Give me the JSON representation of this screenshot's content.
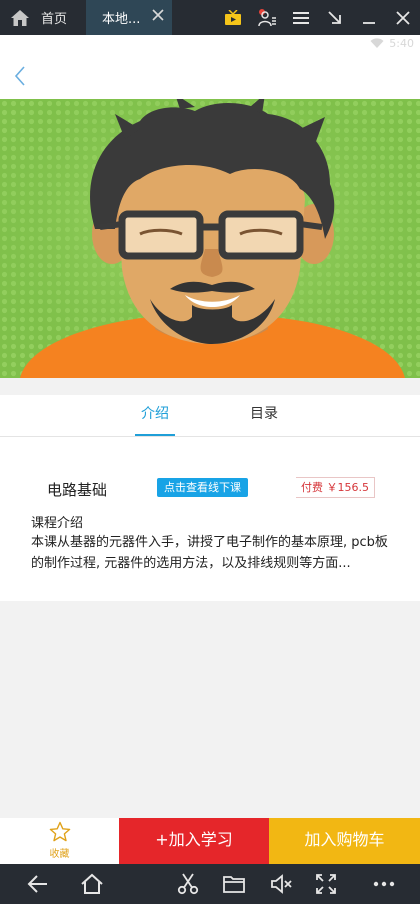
{
  "emulator": {
    "home_tab_label": "首页",
    "active_tab_label": "本地...",
    "tool_icons": [
      "tv-icon",
      "user-settings-icon",
      "menu-icon",
      "minimize-to-corner-icon",
      "minimize-icon",
      "close-icon"
    ],
    "bottom_icons": [
      "back-arrow-icon",
      "home-icon",
      "scissors-icon",
      "folder-icon",
      "mute-icon",
      "fullscreen-icon",
      "more-icon"
    ]
  },
  "status_bar": {
    "time": "5:40"
  },
  "tabs": {
    "intro": "介绍",
    "catalog": "目录"
  },
  "course": {
    "title": "电路基础",
    "offline_button": "点击查看线下课",
    "price": "付费 ￥156.5",
    "intro_label": "课程介绍",
    "intro_text": "本课从基器的元器件入手，讲授了电子制作的基本原理, pcb板的制作过程, 元器件的选用方法，以及排线规则等方面..."
  },
  "actions": {
    "favorite": "收藏",
    "join": "+加入学习",
    "cart": "加入购物车"
  },
  "colors": {
    "accent_blue": "#1f9fd8",
    "join_red": "#e5262a",
    "cart_yellow": "#f2b713",
    "banner_green": "#7fc04a",
    "shirt_orange": "#f58220"
  }
}
